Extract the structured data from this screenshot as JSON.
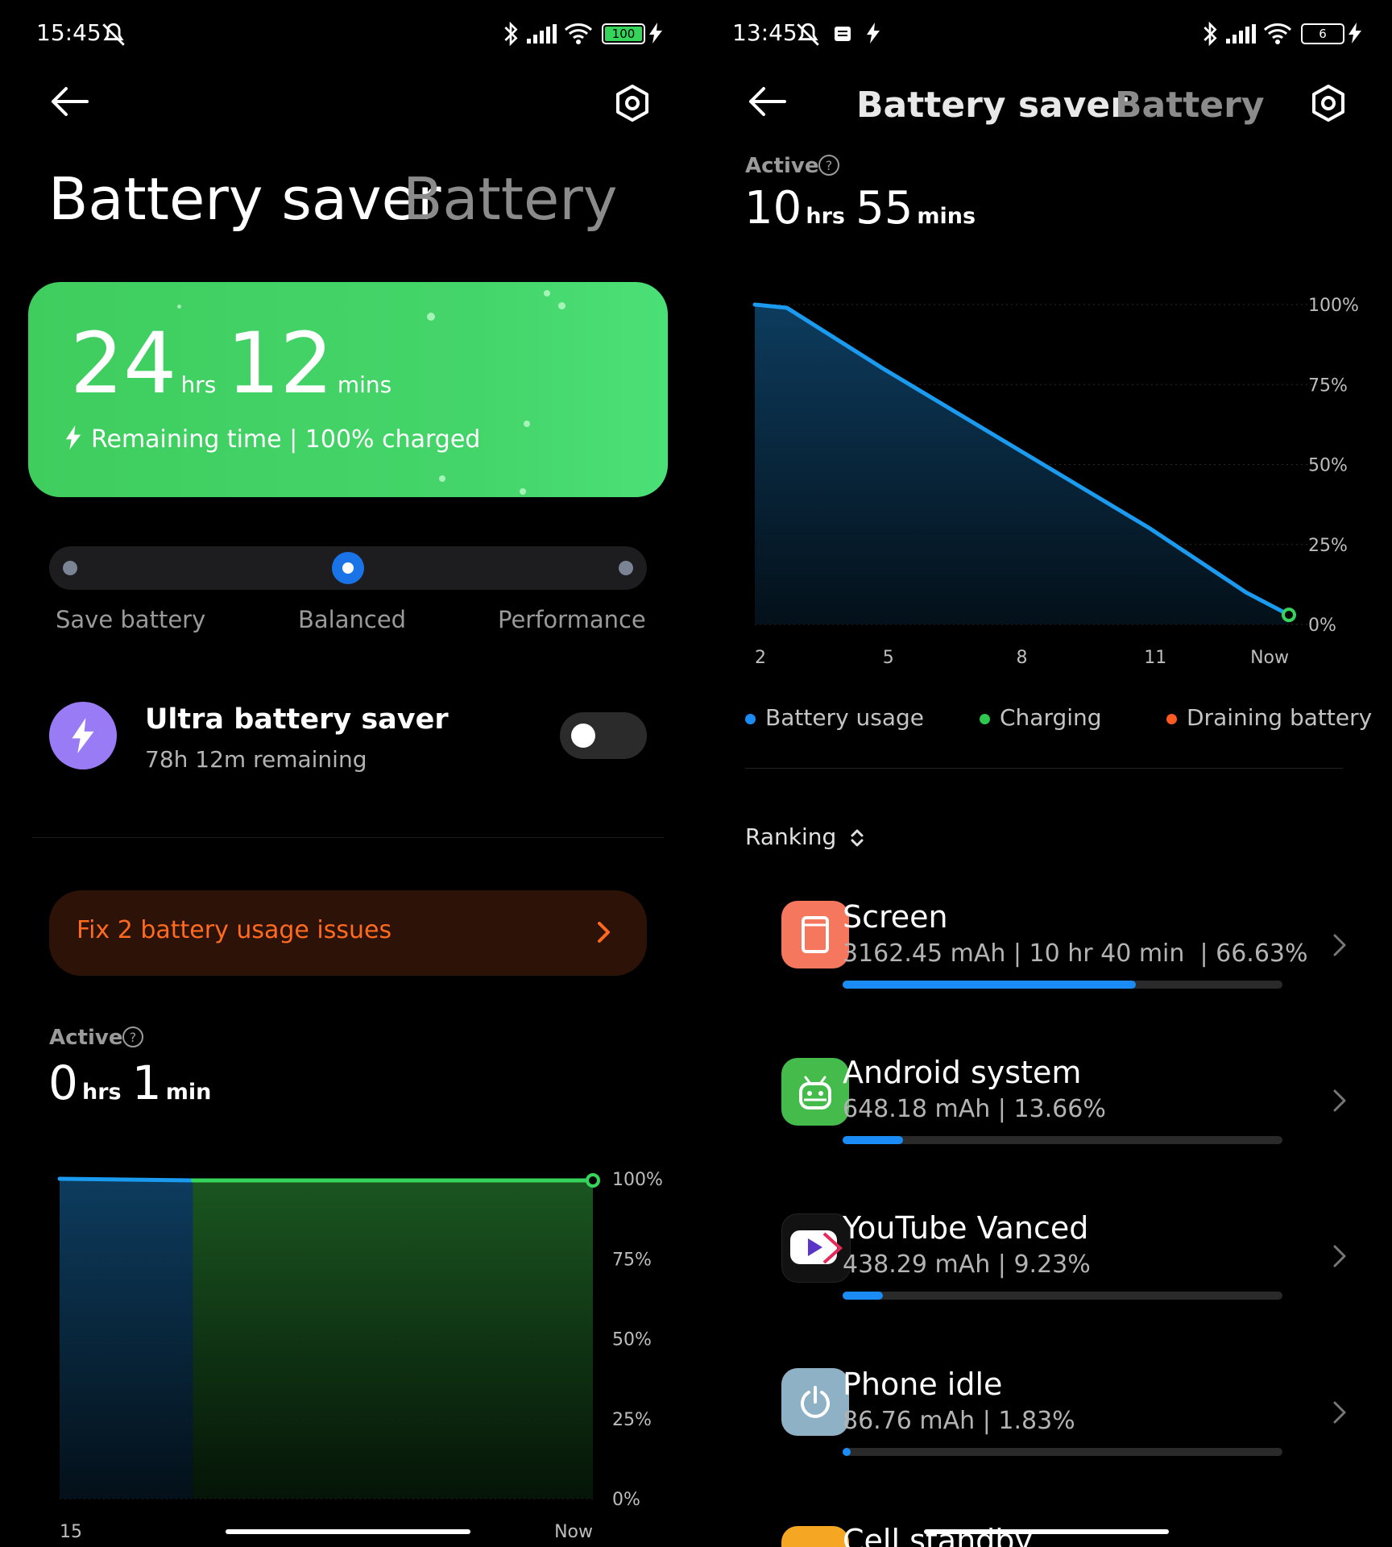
{
  "left": {
    "status": {
      "time": "15:45",
      "battery_level": "100"
    },
    "tabs": {
      "active": "Battery saver",
      "inactive": "Battery"
    },
    "remaining": {
      "hours": "24",
      "hours_unit": "hrs",
      "mins": "12",
      "mins_unit": "mins",
      "caption": "Remaining time | 100% charged"
    },
    "modes": {
      "options": [
        "Save battery",
        "Balanced",
        "Performance"
      ],
      "selected": "Balanced"
    },
    "ultra": {
      "title": "Ultra battery saver",
      "subtitle": "78h 12m remaining",
      "enabled": false
    },
    "fix": {
      "label": "Fix 2 battery usage issues"
    },
    "active": {
      "label": "Active",
      "hours": "0",
      "hours_unit": "hrs",
      "mins": "1",
      "mins_unit": "min"
    },
    "chart_data": {
      "type": "area",
      "x_labels": [
        "15",
        "Now"
      ],
      "y_ticks": [
        "100%",
        "75%",
        "50%",
        "25%",
        "0%"
      ],
      "ylim": [
        0,
        100
      ],
      "series": [
        {
          "name": "Battery usage",
          "color": "#1b9bf0",
          "segment": [
            0,
            0.25
          ],
          "values": [
            100,
            99.5
          ]
        },
        {
          "name": "Charging",
          "color": "#35d45a",
          "segment": [
            0.25,
            1
          ],
          "values": [
            99.5,
            99.5
          ]
        }
      ]
    }
  },
  "right": {
    "status": {
      "time": "13:45",
      "battery_level": "6"
    },
    "tabs": {
      "active": "Battery saver",
      "inactive": "Battery"
    },
    "active": {
      "label": "Active",
      "hours": "10",
      "hours_unit": "hrs",
      "mins": "55",
      "mins_unit": "mins"
    },
    "chart_data": {
      "type": "area",
      "x_labels": [
        "2",
        "5",
        "8",
        "11",
        "Now"
      ],
      "y_ticks": [
        "100%",
        "75%",
        "50%",
        "25%",
        "0%"
      ],
      "ylim": [
        0,
        100
      ],
      "series": [
        {
          "name": "Battery usage",
          "color": "#1b9bf0",
          "x": [
            0,
            0.06,
            0.24,
            0.5,
            0.74,
            0.92,
            1
          ],
          "values": [
            100,
            99,
            80,
            54,
            30,
            10,
            3
          ]
        }
      ]
    },
    "legend": [
      {
        "label": "Battery usage",
        "color": "#1b8cf5"
      },
      {
        "label": "Charging",
        "color": "#2fc84f"
      },
      {
        "label": "Draining battery",
        "color": "#ff5a1f"
      }
    ],
    "ranking_label": "Ranking",
    "apps": [
      {
        "name": "Screen",
        "detail": "3162.45 mAh | 10 hr 40 min  | 66.63%",
        "percent": 66.63,
        "icon": "screen-icon"
      },
      {
        "name": "Android system",
        "detail": "648.18 mAh | 13.66%",
        "percent": 13.66,
        "icon": "android-icon"
      },
      {
        "name": "YouTube Vanced",
        "detail": "438.29 mAh | 9.23%",
        "percent": 9.23,
        "icon": "youtube-vanced-icon"
      },
      {
        "name": "Phone idle",
        "detail": "86.76 mAh | 1.83%",
        "percent": 1.83,
        "icon": "power-icon"
      },
      {
        "name": "Cell standby",
        "detail": "",
        "percent": 0,
        "icon": "cell-standby-icon"
      }
    ]
  }
}
